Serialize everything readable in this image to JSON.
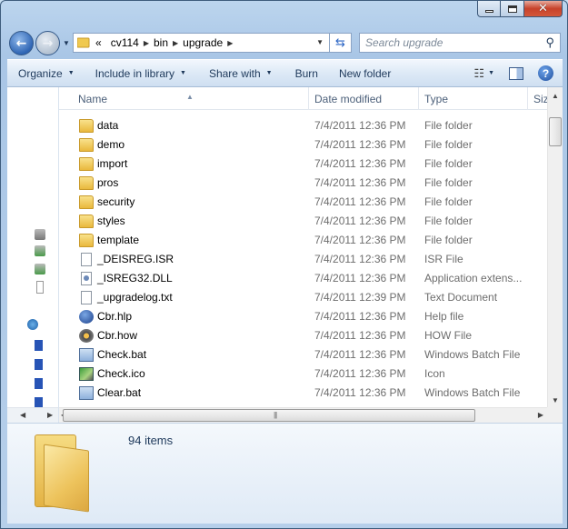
{
  "window": {
    "caption_buttons": [
      "minimize",
      "maximize",
      "close"
    ]
  },
  "nav": {
    "overflow": "«",
    "breadcrumbs": [
      "cv114",
      "bin",
      "upgrade"
    ]
  },
  "search": {
    "placeholder": "Search upgrade"
  },
  "toolbar": {
    "organize": "Organize",
    "include_in_library": "Include in library",
    "share_with": "Share with",
    "burn": "Burn",
    "new_folder": "New folder"
  },
  "columns": {
    "name": "Name",
    "date_modified": "Date modified",
    "type": "Type",
    "size": "Size"
  },
  "files": [
    {
      "name": "data",
      "date": "7/4/2011 12:36 PM",
      "type": "File folder",
      "icon": "folder-icon"
    },
    {
      "name": "demo",
      "date": "7/4/2011 12:36 PM",
      "type": "File folder",
      "icon": "folder-icon"
    },
    {
      "name": "import",
      "date": "7/4/2011 12:36 PM",
      "type": "File folder",
      "icon": "folder-icon"
    },
    {
      "name": "pros",
      "date": "7/4/2011 12:36 PM",
      "type": "File folder",
      "icon": "folder-icon"
    },
    {
      "name": "security",
      "date": "7/4/2011 12:36 PM",
      "type": "File folder",
      "icon": "folder-icon"
    },
    {
      "name": "styles",
      "date": "7/4/2011 12:36 PM",
      "type": "File folder",
      "icon": "folder-icon"
    },
    {
      "name": "template",
      "date": "7/4/2011 12:36 PM",
      "type": "File folder",
      "icon": "folder-icon"
    },
    {
      "name": "_DEISREG.ISR",
      "date": "7/4/2011 12:36 PM",
      "type": "ISR File",
      "icon": "file-icon"
    },
    {
      "name": "_ISREG32.DLL",
      "date": "7/4/2011 12:36 PM",
      "type": "Application extens...",
      "icon": "dll-icon"
    },
    {
      "name": "_upgradelog.txt",
      "date": "7/4/2011 12:39 PM",
      "type": "Text Document",
      "icon": "text-file-icon"
    },
    {
      "name": "Cbr.hlp",
      "date": "7/4/2011 12:36 PM",
      "type": "Help file",
      "icon": "help-file-icon"
    },
    {
      "name": "Cbr.how",
      "date": "7/4/2011 12:36 PM",
      "type": "HOW File",
      "icon": "how-file-icon"
    },
    {
      "name": "Check.bat",
      "date": "7/4/2011 12:36 PM",
      "type": "Windows Batch File",
      "icon": "batch-file-icon"
    },
    {
      "name": "Check.ico",
      "date": "7/4/2011 12:36 PM",
      "type": "Icon",
      "icon": "ico-file-icon"
    },
    {
      "name": "Clear.bat",
      "date": "7/4/2011 12:36 PM",
      "type": "Windows Batch File",
      "icon": "batch-file-icon"
    }
  ],
  "details": {
    "item_count": "94 items"
  }
}
